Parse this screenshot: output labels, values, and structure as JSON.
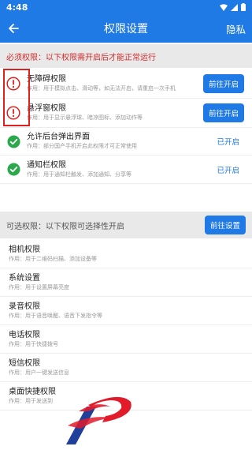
{
  "status": {
    "time": "4:48"
  },
  "header": {
    "title": "权限设置",
    "right_action": "隐私"
  },
  "required": {
    "header": "必须权限：以下权限需开启后才能正常运行",
    "items": [
      {
        "name": "无障碍权限",
        "desc": "作用：用于模拟点击、滑动等，如无法开启，请重启一次手机",
        "status": "button",
        "action": "前往开启"
      },
      {
        "name": "悬浮窗权限",
        "desc": "作用：用于显示悬浮球、暗凉图标、添加动作等",
        "status": "button",
        "action": "前往开启"
      },
      {
        "name": "允许后台弹出界面",
        "desc": "作用：部分国产手机开启此权限才可正常使用",
        "status": "done",
        "action": "已开启"
      },
      {
        "name": "通知栏权限",
        "desc": "作用：用于通知栏触发、添加通知、分享等",
        "status": "done",
        "action": "已开启"
      }
    ]
  },
  "optional": {
    "header": "可选权限：以下权限可选择性开启",
    "button": "前往设置",
    "items": [
      {
        "name": "相机权限",
        "desc": "作用：用于二维码扫描、添加设备等"
      },
      {
        "name": "系统设置",
        "desc": "作用：用于设置屏幕亮度"
      },
      {
        "name": "录音权限",
        "desc": "作用：用于语音唤醒、语音下发指令等"
      },
      {
        "name": "电话权限",
        "desc": "作用：用于快捷拨号"
      },
      {
        "name": "短信权限",
        "desc": "作用：用户一键发送信息"
      },
      {
        "name": "桌面快捷权限",
        "desc": "作用：用于发送到"
      }
    ]
  },
  "colors": {
    "primary": "#1f7ae5",
    "warning": "#e02020",
    "success": "#2aa84a"
  }
}
